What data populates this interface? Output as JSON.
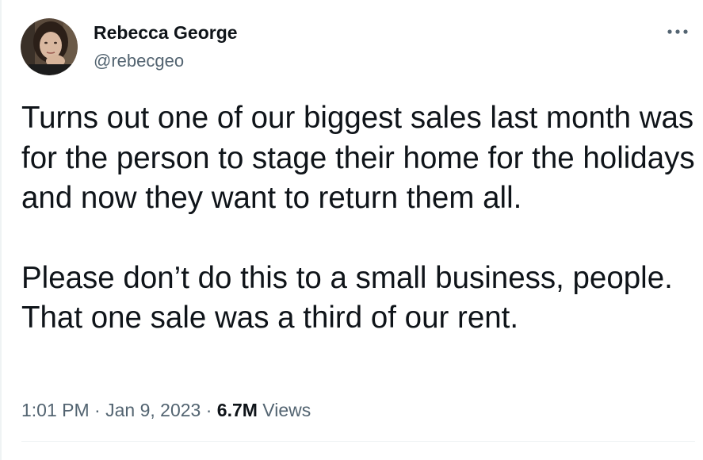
{
  "author": {
    "display_name": "Rebecca George",
    "handle": "@rebecgeo"
  },
  "tweet": {
    "paragraphs": [
      "Turns out one of our biggest sales last month was for the person to stage their home for the holidays and now they want to return them all.",
      "Please don’t do this to a small business, people. That one sale was a third of our rent."
    ]
  },
  "meta": {
    "time": "1:01 PM",
    "separator": " · ",
    "date": "Jan 9, 2023",
    "views_count": "6.7M",
    "views_label": " Views"
  },
  "icons": {
    "more": "more-horizontal-icon"
  },
  "colors": {
    "text_primary": "#0f1419",
    "text_secondary": "#536471",
    "divider": "#eff3f4"
  }
}
